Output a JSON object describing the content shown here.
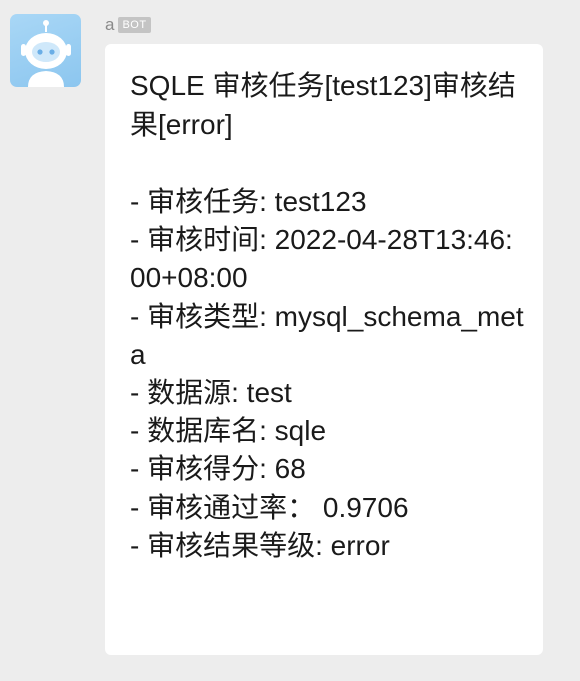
{
  "sender": {
    "name": "a",
    "badge": "BOT"
  },
  "message": {
    "title": "SQLE 审核任务[test123]审核结果[error]",
    "lines": [
      "- 审核任务: test123",
      "- 审核时间: 2022-04-28T13:46:00+08:00",
      "- 审核类型: mysql_schema_meta",
      "- 数据源: test",
      "- 数据库名: sqle",
      "- 审核得分: 68",
      "- 审核通过率： 0.9706",
      "- 审核结果等级: error"
    ]
  },
  "colors": {
    "background": "#ededed",
    "bubble": "#ffffff",
    "avatar": "#8cc6ef",
    "text": "#1a1a1a"
  },
  "icons": {
    "avatar": "robot-icon"
  }
}
